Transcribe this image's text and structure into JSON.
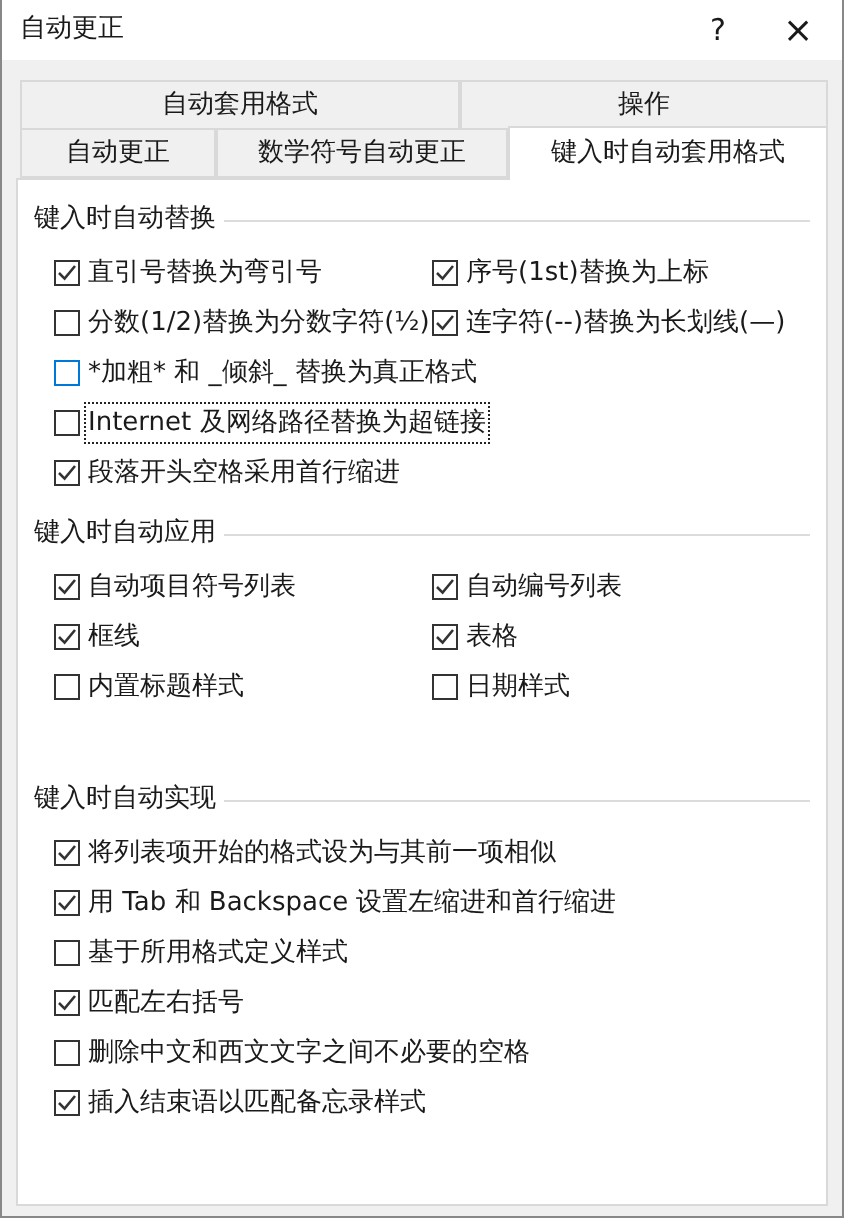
{
  "window": {
    "title": "自动更正",
    "help": "?",
    "close": "×"
  },
  "tab_rows": [
    [
      {
        "label": "自动套用格式",
        "selected": false
      },
      {
        "label": "操作",
        "selected": false
      }
    ],
    [
      {
        "label": "自动更正",
        "selected": false
      },
      {
        "label": "数学符号自动更正",
        "selected": false
      },
      {
        "label": "键入时自动套用格式",
        "selected": true
      }
    ]
  ],
  "sections": [
    {
      "title": "键入时自动替换",
      "rows": [
        [
          {
            "label": "直引号替换为弯引号",
            "checked": true,
            "hovered": false,
            "focused": false
          },
          {
            "label": "序号(1st)替换为上标",
            "checked": true,
            "hovered": false,
            "focused": false
          }
        ],
        [
          {
            "label": "分数(1/2)替换为分数字符(½)",
            "checked": false,
            "hovered": false,
            "focused": false
          },
          {
            "label": "连字符(--)替换为长划线(—)",
            "checked": true,
            "hovered": false,
            "focused": false
          }
        ],
        [
          {
            "label": "*加粗* 和 _倾斜_ 替换为真正格式",
            "checked": false,
            "hovered": true,
            "focused": false
          }
        ],
        [
          {
            "label": "Internet 及网络路径替换为超链接",
            "checked": false,
            "hovered": false,
            "focused": true
          }
        ],
        [
          {
            "label": "段落开头空格采用首行缩进",
            "checked": true,
            "hovered": false,
            "focused": false
          }
        ]
      ]
    },
    {
      "title": "键入时自动应用",
      "rows": [
        [
          {
            "label": "自动项目符号列表",
            "checked": true,
            "hovered": false,
            "focused": false
          },
          {
            "label": "自动编号列表",
            "checked": true,
            "hovered": false,
            "focused": false
          }
        ],
        [
          {
            "label": "框线",
            "checked": true,
            "hovered": false,
            "focused": false
          },
          {
            "label": "表格",
            "checked": true,
            "hovered": false,
            "focused": false
          }
        ],
        [
          {
            "label": "内置标题样式",
            "checked": false,
            "hovered": false,
            "focused": false
          },
          {
            "label": "日期样式",
            "checked": false,
            "hovered": false,
            "focused": false
          }
        ]
      ]
    },
    {
      "title": "键入时自动实现",
      "rows": [
        [
          {
            "label": "将列表项开始的格式设为与其前一项相似",
            "checked": true,
            "hovered": false,
            "focused": false
          }
        ],
        [
          {
            "label": "用 Tab 和 Backspace 设置左缩进和首行缩进",
            "checked": true,
            "hovered": false,
            "focused": false
          }
        ],
        [
          {
            "label": "基于所用格式定义样式",
            "checked": false,
            "hovered": false,
            "focused": false
          }
        ],
        [
          {
            "label": "匹配左右括号",
            "checked": true,
            "hovered": false,
            "focused": false
          }
        ],
        [
          {
            "label": "删除中文和西文文字之间不必要的空格",
            "checked": false,
            "hovered": false,
            "focused": false
          }
        ],
        [
          {
            "label": "插入结束语以匹配备忘录样式",
            "checked": true,
            "hovered": false,
            "focused": false
          }
        ]
      ]
    }
  ]
}
